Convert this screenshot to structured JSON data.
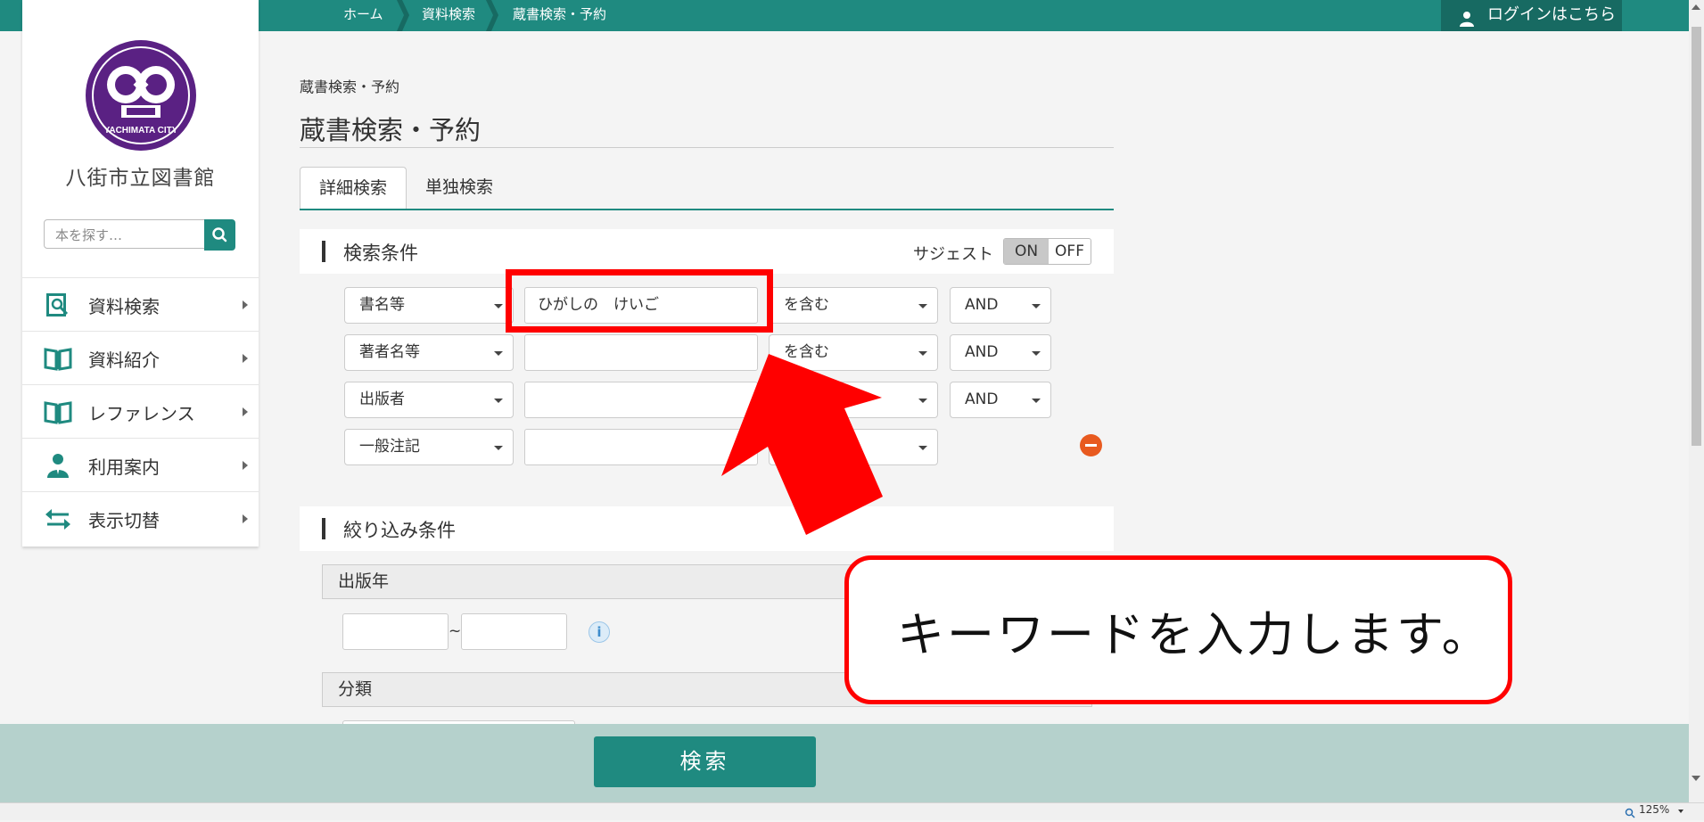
{
  "topnav": {
    "crumbs": [
      "ホーム",
      "資料検索",
      "蔵書検索・予約"
    ],
    "login_label": "ログインはこちら"
  },
  "sidebar": {
    "logo_text": "YACHIMATA CITY",
    "library_name": "八街市立図書館",
    "search_placeholder": "本を探す…",
    "items": [
      {
        "label": "資料検索",
        "icon": "book-search-icon"
      },
      {
        "label": "資料紹介",
        "icon": "open-book-icon"
      },
      {
        "label": "レファレンス",
        "icon": "open-book-icon"
      },
      {
        "label": "利用案内",
        "icon": "person-icon"
      },
      {
        "label": "表示切替",
        "icon": "swap-arrows-icon"
      }
    ]
  },
  "page": {
    "breadcrumb": "蔵書検索・予約",
    "title": "蔵書検索・予約",
    "tabs": [
      "詳細検索",
      "単独検索"
    ],
    "active_tab": "詳細検索"
  },
  "conditions": {
    "heading": "検索条件",
    "suggest_label": "サジェスト",
    "suggest_on": "ON",
    "suggest_off": "OFF",
    "rows": [
      {
        "field": "書名等",
        "value": "ひがしの　けいご",
        "match": "を含む",
        "op": "AND"
      },
      {
        "field": "著者名等",
        "value": "",
        "match": "を含む",
        "op": "AND"
      },
      {
        "field": "出版者",
        "value": "",
        "match": "",
        "op": "AND"
      },
      {
        "field": "一般注記",
        "value": "",
        "match": "",
        "op": ""
      }
    ]
  },
  "filters": {
    "heading": "絞り込み条件",
    "pub_year_label": "出版年",
    "tilde": "~",
    "info_symbol": "i",
    "class_label": "分類"
  },
  "footer": {
    "search_button": "検索"
  },
  "browser": {
    "zoom": "125%"
  },
  "annotation": {
    "callout_text": "キーワードを入力します。",
    "highlight_color": "#ff0000"
  },
  "colors": {
    "brand": "#1f8a80",
    "footer_bg": "#b5d1cc",
    "logo_purple": "#5a2183"
  }
}
